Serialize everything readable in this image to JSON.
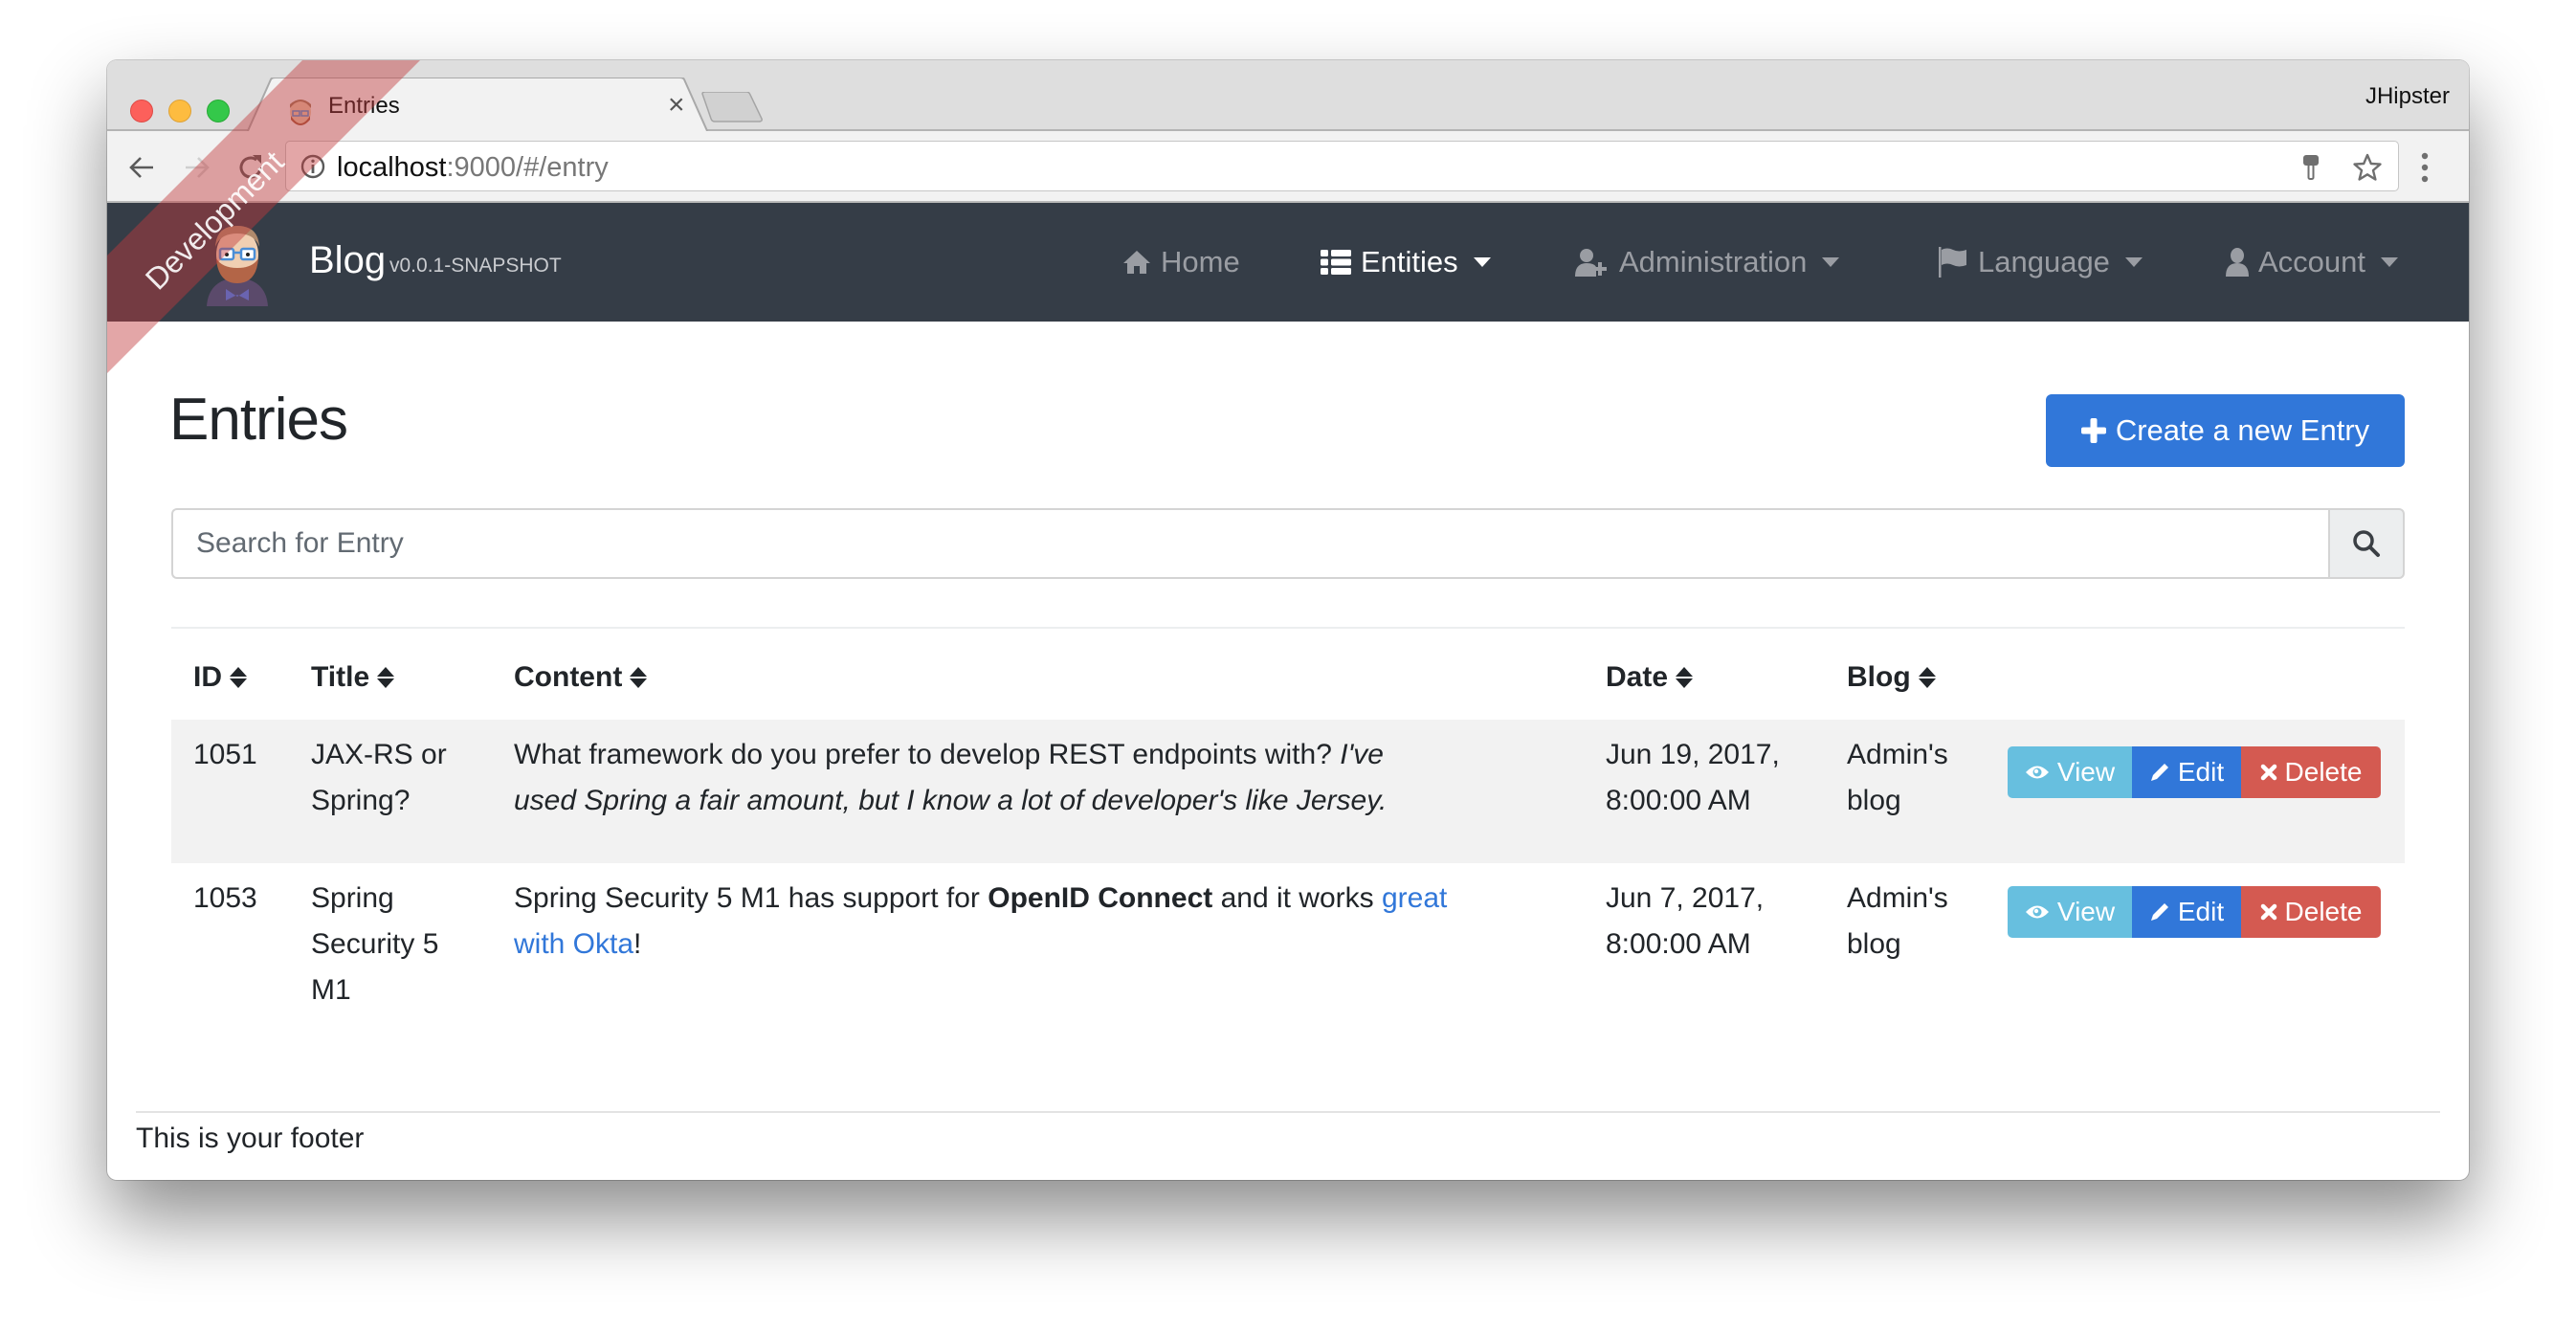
{
  "browser": {
    "profile_name": "JHipster",
    "tab": {
      "title": "Entries",
      "favicon": "jhipster-avatar-icon",
      "close": "×"
    },
    "url": {
      "host": "localhost",
      "rest": ":9000/#/entry"
    },
    "icons": [
      "back-arrow-icon",
      "forward-arrow-icon",
      "reload-icon",
      "info-icon",
      "key-icon",
      "star-icon",
      "menu-dots-icon"
    ]
  },
  "navbar": {
    "brand": "Blog",
    "version": "v0.0.1-SNAPSHOT",
    "ribbon": "Development",
    "items": [
      {
        "label": "Home",
        "icon": "home-icon",
        "dropdown": false,
        "active": false
      },
      {
        "label": "Entities",
        "icon": "list-icon",
        "dropdown": true,
        "active": true
      },
      {
        "label": "Administration",
        "icon": "user-plus-icon",
        "dropdown": true,
        "active": false
      },
      {
        "label": "Language",
        "icon": "flag-icon",
        "dropdown": true,
        "active": false
      },
      {
        "label": "Account",
        "icon": "user-icon",
        "dropdown": true,
        "active": false
      }
    ]
  },
  "page": {
    "title": "Entries",
    "create_button": "Create a new Entry",
    "search": {
      "placeholder": "Search for Entry",
      "value": ""
    }
  },
  "table": {
    "columns": [
      "ID",
      "Title",
      "Content",
      "Date",
      "Blog"
    ],
    "rows": [
      {
        "id": "1051",
        "title_lines": [
          "JAX-RS or",
          "Spring?"
        ],
        "content": {
          "line1_plain": "What framework do you prefer to develop REST endpoints with? ",
          "line1_italic": "I've",
          "line2_italic": "used Spring a fair amount, but I know a lot of developer's like Jersey."
        },
        "date_lines": [
          "Jun 19, 2017,",
          "8:00:00 AM"
        ],
        "blog_lines": [
          "Admin's",
          "blog"
        ],
        "actions": [
          "View",
          "Edit",
          "Delete"
        ]
      },
      {
        "id": "1053",
        "title_lines": [
          "Spring",
          "Security 5",
          "M1"
        ],
        "content": {
          "plain1": "Spring Security 5 M1 has support for ",
          "bold": "OpenID Connect",
          "plain2": " and it works ",
          "link1": "great",
          "link2": "with Okta",
          "end": "!"
        },
        "date_lines": [
          "Jun 7, 2017,",
          "8:00:00 AM"
        ],
        "blog_lines": [
          "Admin's",
          "blog"
        ],
        "actions": [
          "View",
          "Edit",
          "Delete"
        ]
      }
    ]
  },
  "footer": {
    "text": "This is your footer"
  },
  "colors": {
    "navbar_bg": "#353d47",
    "primary": "#3177d9",
    "info": "#67bfdf",
    "danger": "#d45a51",
    "ribbon": "#c0393b"
  }
}
